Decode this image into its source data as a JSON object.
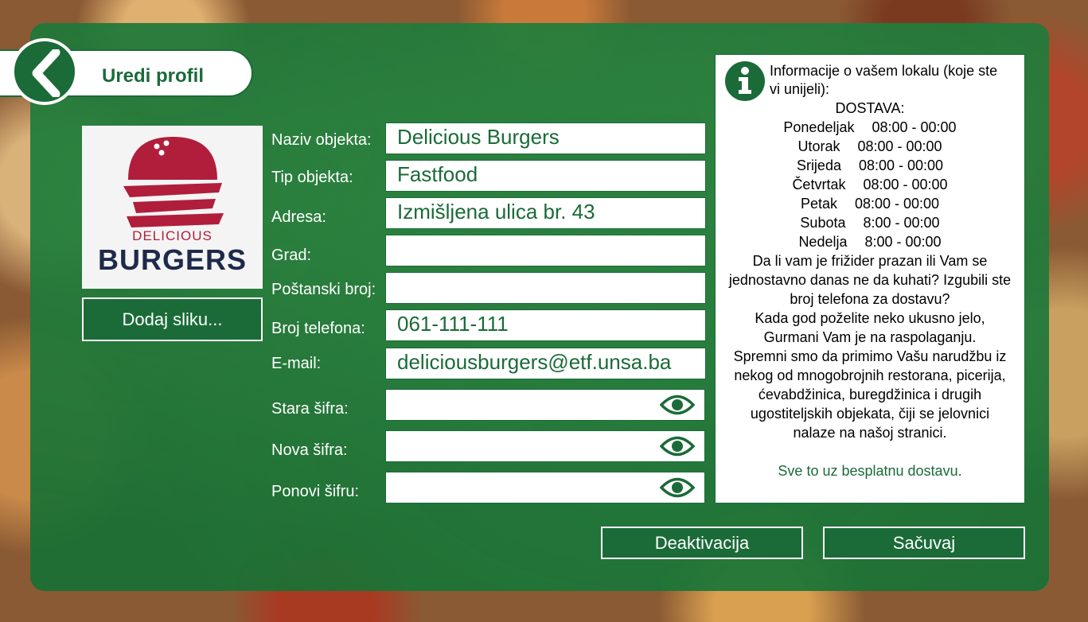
{
  "header": {
    "title": "Uredi profil"
  },
  "logo": {
    "word1": "DELICIOUS",
    "word2": "BURGERS"
  },
  "add_image_label": "Dodaj sliku...",
  "form": {
    "fields": [
      {
        "label": "Naziv objekta:",
        "value": "Delicious Burgers"
      },
      {
        "label": "Tip objekta:",
        "value": "Fastfood"
      },
      {
        "label": "Adresa:",
        "value": "Izmišljena ulica br. 43"
      },
      {
        "label": "Grad:",
        "value": ""
      },
      {
        "label": "Poštanski broj:",
        "value": ""
      },
      {
        "label": "Broj telefona:",
        "value": "061-111-111"
      },
      {
        "label": "E-mail:",
        "value": "deliciousburgers@etf.unsa.ba"
      }
    ],
    "passwords": [
      {
        "label": "Stara šifra:",
        "value": ""
      },
      {
        "label": "Nova šifra:",
        "value": ""
      },
      {
        "label": "Ponovi šifru:",
        "value": ""
      }
    ]
  },
  "info": {
    "heading": "Informacije o vašem lokalu (koje ste vi unijeli):",
    "delivery_label": "DOSTAVA:",
    "schedule": [
      {
        "day": "Ponedeljak",
        "hours": "08:00 - 00:00"
      },
      {
        "day": "Utorak",
        "hours": "08:00 - 00:00"
      },
      {
        "day": "Srijeda",
        "hours": "08:00 - 00:00"
      },
      {
        "day": "Četvrtak",
        "hours": "08:00 - 00:00"
      },
      {
        "day": "Petak",
        "hours": "08:00 - 00:00"
      },
      {
        "day": "Subota",
        "hours": "8:00 - 00:00"
      },
      {
        "day": "Nedelja",
        "hours": "8:00 - 00:00"
      }
    ],
    "description_lines": [
      "Da li vam je frižider prazan ili Vam se",
      "jednostavno danas ne da kuhati? Izgubili ste",
      "broj telefona za dostavu?",
      "Kada god poželite neko ukusno jelo,",
      "Gurmani Vam je na raspolaganju.",
      "Spremni smo da primimo Vašu narudžbu iz",
      "nekog od mnogobrojnih restorana, picerija,",
      "ćevabdžinica, buregdžinica i drugih",
      "ugostiteljskih objekata, čiji se jelovnici",
      "nalaze na našoj stranici."
    ],
    "closing": "Sve to uz besplatnu dostavu."
  },
  "actions": {
    "deactivate": "Deaktivacija",
    "save": "Sačuvaj"
  },
  "colors": {
    "brand_green": "#1a6b38",
    "logo_red": "#b01e3c",
    "logo_navy": "#1d2a4a"
  }
}
